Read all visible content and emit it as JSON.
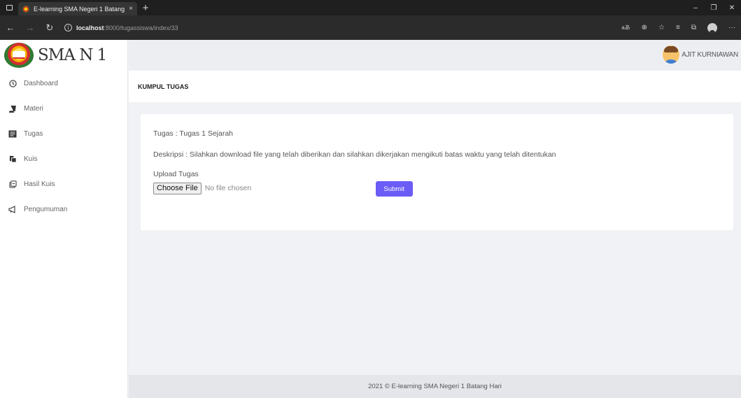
{
  "browser": {
    "tab_title": "E-learning SMA Negeri 1 Batang",
    "tab_close": "×",
    "new_tab": "+",
    "url_host": "localhost",
    "url_rest": ":8000/tugassiswa/index/33",
    "url_info": "i",
    "reader_icon_text": "aあ",
    "minimize": "–",
    "maximize": "❐",
    "close": "✕",
    "more": "···"
  },
  "sidebar": {
    "logo_text": "SMA N 1",
    "items": [
      {
        "label": "Dashboard",
        "icon": "dashboard-icon"
      },
      {
        "label": "Materi",
        "icon": "book-icon"
      },
      {
        "label": "Tugas",
        "icon": "assignment-icon"
      },
      {
        "label": "Kuis",
        "icon": "quiz-icon"
      },
      {
        "label": "Hasil Kuis",
        "icon": "result-icon"
      },
      {
        "label": "Pengumuman",
        "icon": "megaphone-icon"
      }
    ]
  },
  "header": {
    "user_name": "AJIT KURNIAWAN"
  },
  "page": {
    "title": "KUMPUL TUGAS"
  },
  "form": {
    "task_line": "Tugas : Tugas 1 Sejarah",
    "description_line": "Deskripsi : Silahkan download file yang telah diberikan dan silahkan dikerjakan mengikuti batas waktu yang telah ditentukan",
    "upload_label": "Upload Tugas",
    "file_button": "Choose File",
    "file_status": "No file chosen",
    "submit_label": "Submit"
  },
  "footer": {
    "text": "2021 © E-learning SMA Negeri 1 Batang Hari"
  },
  "colors": {
    "accent": "#6b5cf6",
    "sidebar_bg": "#ffffff",
    "content_bg": "#f1f2f5"
  }
}
